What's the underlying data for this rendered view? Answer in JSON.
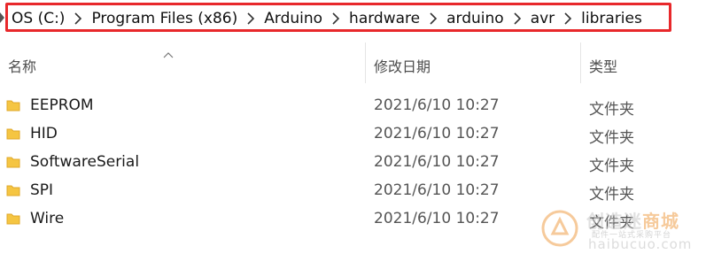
{
  "address_bar": {
    "segments": [
      "OS (C:)",
      "Program Files (x86)",
      "Arduino",
      "hardware",
      "arduino",
      "avr",
      "libraries"
    ],
    "highlight_color": "#e8282b"
  },
  "columns": {
    "name": "名称",
    "modified": "修改日期",
    "type": "类型"
  },
  "files": [
    {
      "name": "EEPROM",
      "modified": "2021/6/10 10:27",
      "type": "文件夹"
    },
    {
      "name": "HID",
      "modified": "2021/6/10 10:27",
      "type": "文件夹"
    },
    {
      "name": "SoftwareSerial",
      "modified": "2021/6/10 10:27",
      "type": "文件夹"
    },
    {
      "name": "SPI",
      "modified": "2021/6/10 10:27",
      "type": "文件夹"
    },
    {
      "name": "Wire",
      "modified": "2021/6/10 10:27",
      "type": "文件夹"
    }
  ],
  "watermark": {
    "title_plain": "创造迷",
    "title_accent": "商城",
    "subtitle": "配件一站式采购平台",
    "url": "haibucuo.com"
  },
  "colors": {
    "folder": "#f5c542",
    "folder_dark": "#e0a82a",
    "watermark_accent": "#f0a04b"
  }
}
